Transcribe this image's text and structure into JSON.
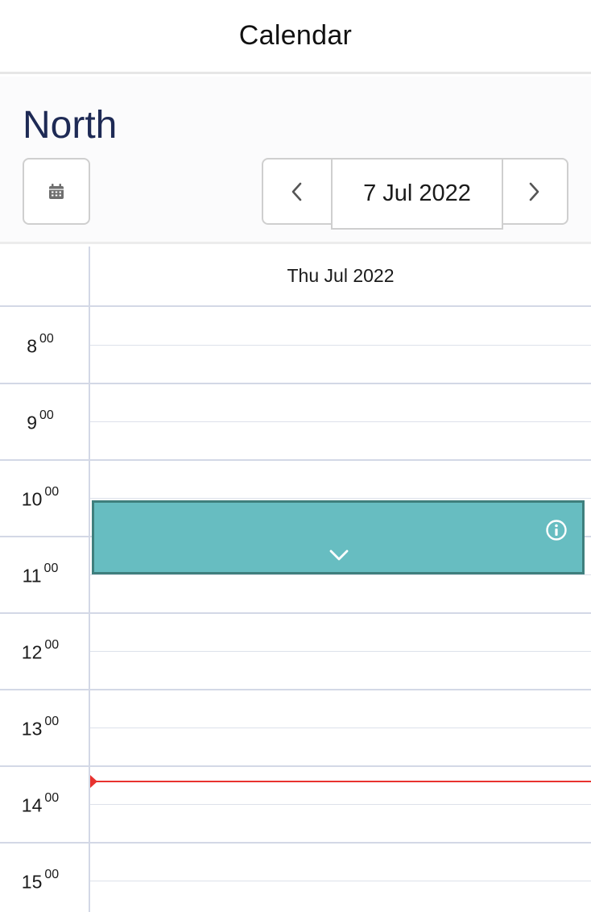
{
  "app": {
    "title": "Calendar"
  },
  "location": {
    "name": "North"
  },
  "date_nav": {
    "current_date": "7 Jul 2022",
    "prev_icon": "chevron-left-icon",
    "next_icon": "chevron-right-icon",
    "calendar_icon": "calendar-icon"
  },
  "day_view": {
    "day_header": "Thu Jul 2022",
    "hours": [
      {
        "hour": "8",
        "minutes": "00"
      },
      {
        "hour": "9",
        "minutes": "00"
      },
      {
        "hour": "10",
        "minutes": "00"
      },
      {
        "hour": "11",
        "minutes": "00"
      },
      {
        "hour": "12",
        "minutes": "00"
      },
      {
        "hour": "13",
        "minutes": "00"
      },
      {
        "hour": "14",
        "minutes": "00"
      },
      {
        "hour": "15",
        "minutes": "00"
      }
    ],
    "event": {
      "color": "#67bdc1",
      "border_color": "#3f7f7d",
      "info_icon": "info-icon",
      "expand_icon": "chevron-down-icon"
    },
    "now_indicator_color": "#e8322f"
  },
  "colors": {
    "title": "#1e2a55",
    "grid": "#d3d8e6"
  }
}
